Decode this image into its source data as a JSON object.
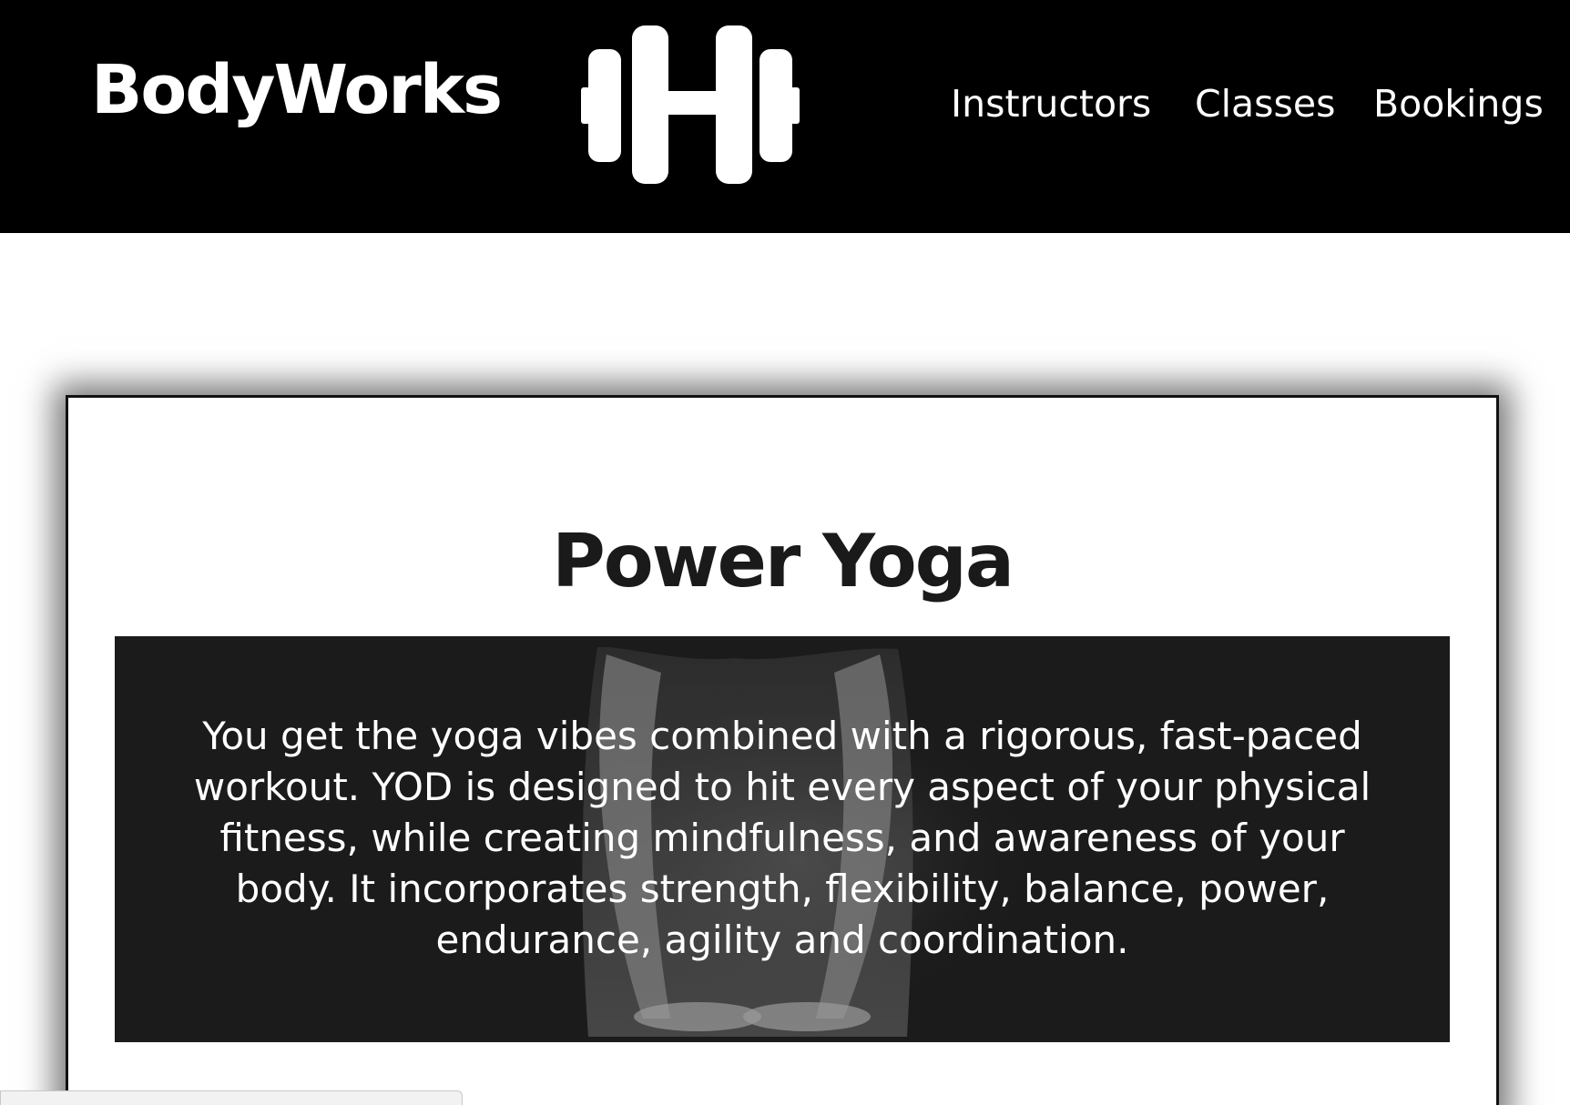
{
  "header": {
    "brand": "BodyWorks",
    "logo_icon": "dumbbell-icon",
    "nav": [
      {
        "label": "Instructors"
      },
      {
        "label": "Classes"
      },
      {
        "label": "Bookings"
      }
    ]
  },
  "main": {
    "class_title": "Power Yoga",
    "description": "You get the yoga vibes combined with a rigorous, fast-paced workout. YOD is designed to hit every aspect of your physical fitness, while creating mindfulness, and awareness of your body. It incorporates strength, flexibility, balance, power, endurance, agility and coordination."
  },
  "colors": {
    "header_bg": "#000000",
    "card_bg": "#ffffff",
    "hero_bg": "#1b1b1b",
    "text_light": "#ffffff",
    "text_dark": "#1a1a1a"
  }
}
